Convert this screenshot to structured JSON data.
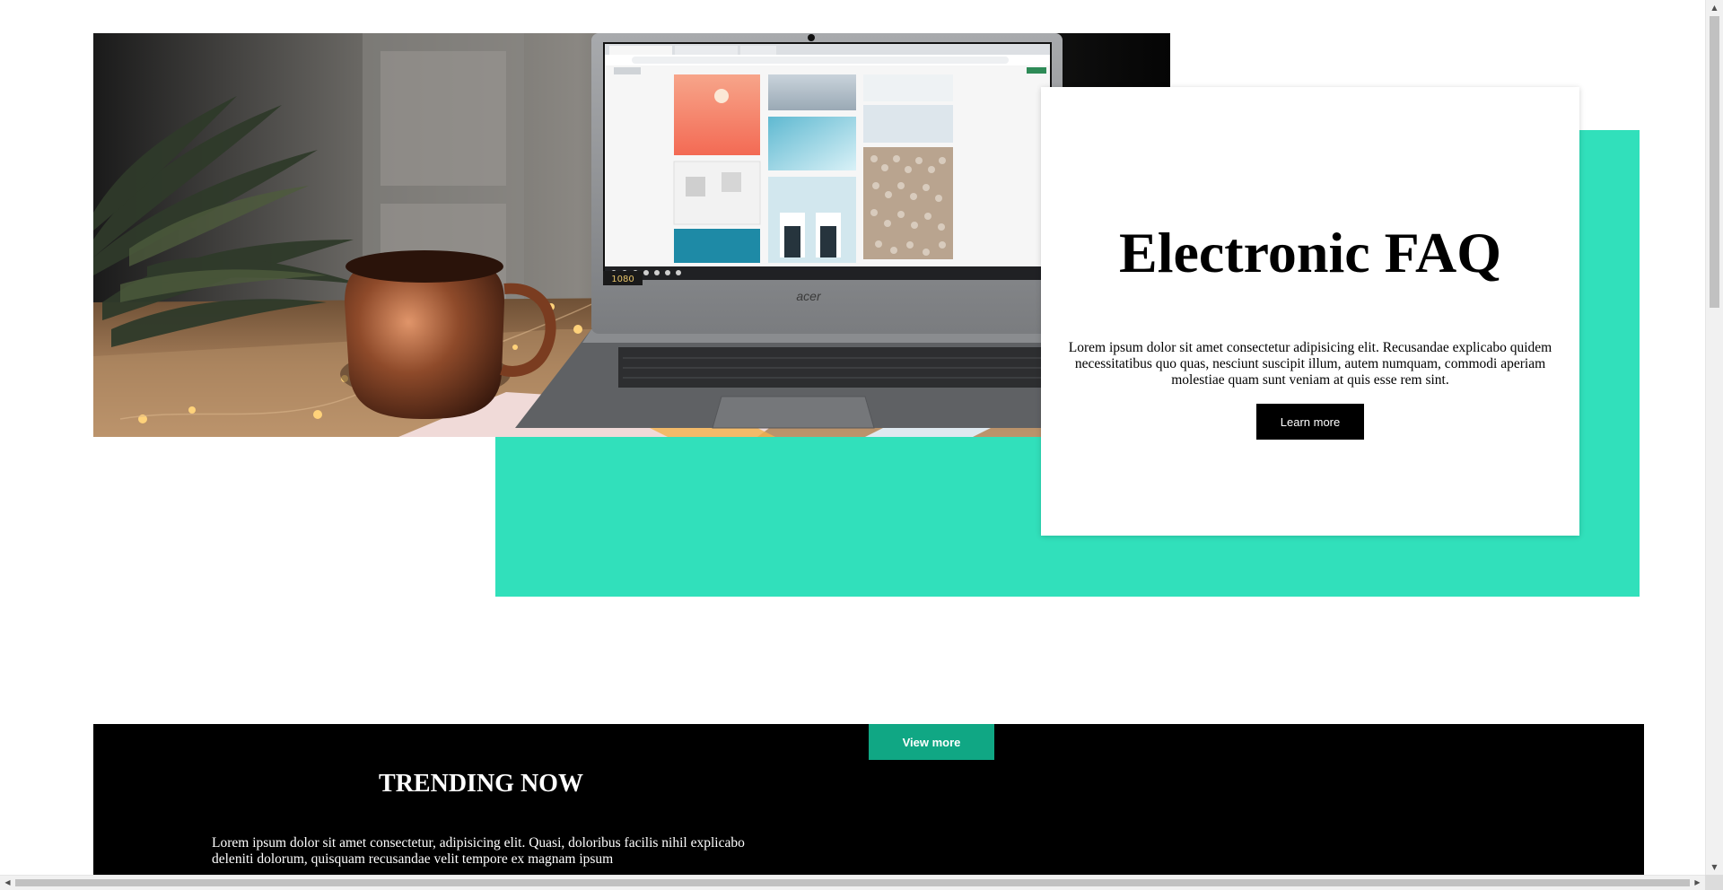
{
  "hero": {
    "image_alt": "Laptop on a wooden desk beside a copper mug and string lights",
    "laptop_brand": "acer",
    "video_badge": "1080"
  },
  "card": {
    "title": "Electronic FAQ",
    "body": "Lorem ipsum dolor sit amet consectetur adipisicing elit. Recusandae explicabo quidem necessitatibus quo quas, nesciunt suscipit illum, autem numquam, commodi aperiam molestiae quam sunt veniam at quis esse rem sint.",
    "button_label": "Learn more"
  },
  "trending": {
    "button_label": "View more",
    "title": "TRENDING NOW",
    "body": "Lorem ipsum dolor sit amet consectetur, adipisicing elit. Quasi, doloribus facilis nihil explicabo deleniti dolorum, quisquam recusandae velit tempore ex magnam ipsum"
  },
  "colors": {
    "teal_block": "#31e0bb",
    "view_more_button": "#10a784",
    "learn_more_button": "#000000",
    "trending_background": "#000000"
  },
  "icons": {
    "scroll_up": "triangle-up",
    "scroll_down": "triangle-down",
    "scroll_left": "triangle-left",
    "scroll_right": "triangle-right"
  }
}
